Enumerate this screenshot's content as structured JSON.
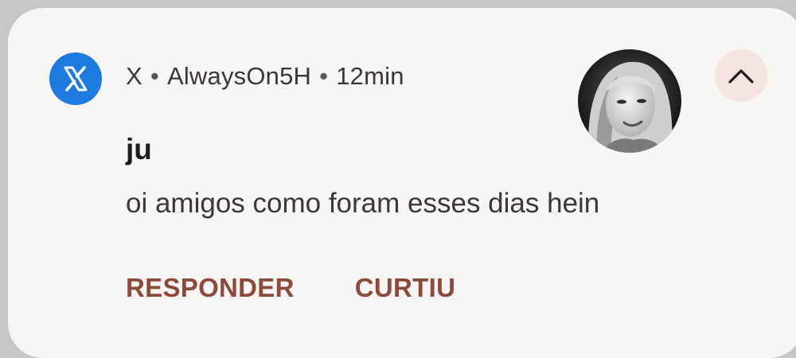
{
  "notification": {
    "app_name": "X",
    "app_icon": "x-logo-icon",
    "app_icon_color": "#1d7be0",
    "separator": "•",
    "account": "AlwaysOn5H",
    "time": "12min",
    "title": "ju",
    "message": "oi amigos como foram esses dias hein",
    "avatar": "profile-photo",
    "collapse_icon": "chevron-up-icon",
    "actions": [
      {
        "label": "RESPONDER"
      },
      {
        "label": "CURTIU"
      }
    ],
    "action_color": "#8c4a3c"
  }
}
